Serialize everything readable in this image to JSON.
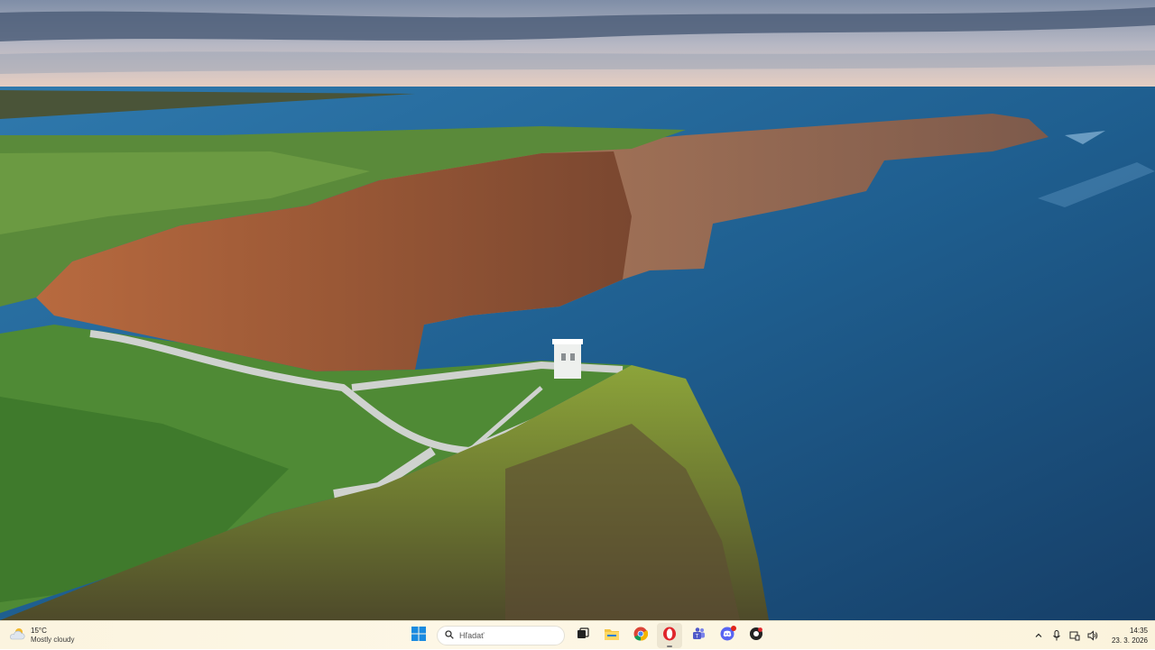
{
  "wallpaper": {
    "subject": "cliffs-of-moher-landscape"
  },
  "weather": {
    "temperature": "15°C",
    "condition": "Mostly cloudy",
    "icon": "cloud-sun-icon"
  },
  "search": {
    "placeholder": "Hľadať"
  },
  "taskbar_apps": [
    {
      "name": "start-button",
      "icon": "windows-logo-icon"
    },
    {
      "name": "task-view-button",
      "icon": "task-view-icon"
    },
    {
      "name": "file-explorer-button",
      "icon": "folder-icon"
    },
    {
      "name": "chrome-button",
      "icon": "chrome-icon"
    },
    {
      "name": "opera-button",
      "icon": "opera-icon",
      "active": true
    },
    {
      "name": "teams-button",
      "icon": "teams-icon"
    },
    {
      "name": "discord-button",
      "icon": "discord-icon",
      "badge": true
    },
    {
      "name": "app-button",
      "icon": "app-icon"
    }
  ],
  "tray": {
    "icons": [
      "chevron-up-icon",
      "microphone-icon",
      "network-icon",
      "volume-icon"
    ]
  },
  "clock": {
    "time": "14:35",
    "date": "23. 3. 2026"
  },
  "colors": {
    "taskbar_bg": "#fbf4df",
    "accent": "#0067c0",
    "badge": "#e0251b"
  }
}
